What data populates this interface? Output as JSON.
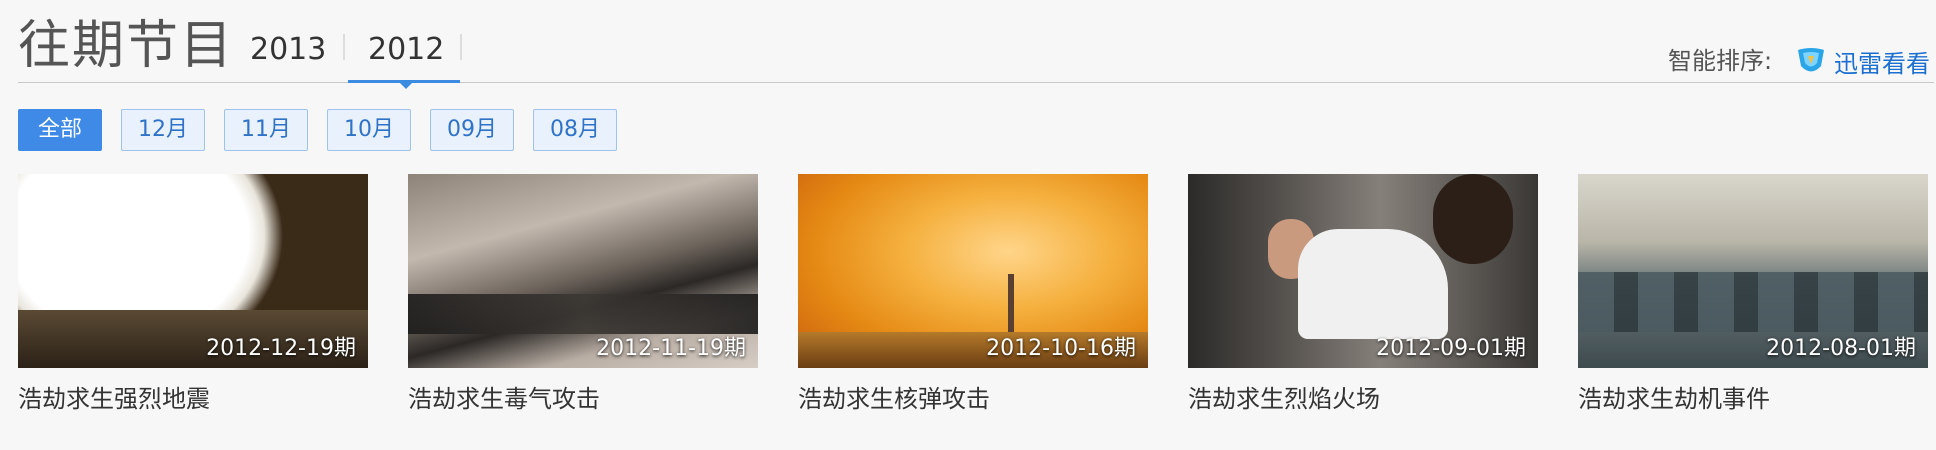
{
  "header": {
    "title": "往期节目",
    "year_tabs": [
      {
        "label": "2013",
        "active": false
      },
      {
        "label": "2012",
        "active": true
      }
    ],
    "sort_label": "智能排序:",
    "sort_link": {
      "label": "迅雷看看",
      "icon": "xunlei-logo-icon"
    }
  },
  "filters": [
    {
      "label": "全部",
      "active": true
    },
    {
      "label": "12月",
      "active": false
    },
    {
      "label": "11月",
      "active": false
    },
    {
      "label": "10月",
      "active": false
    },
    {
      "label": "09月",
      "active": false
    },
    {
      "label": "08月",
      "active": false
    }
  ],
  "episodes": [
    {
      "date": "2012-12-19期",
      "title": "浩劫求生强烈地震"
    },
    {
      "date": "2012-11-19期",
      "title": "浩劫求生毒气攻击"
    },
    {
      "date": "2012-10-16期",
      "title": "浩劫求生核弹攻击"
    },
    {
      "date": "2012-09-01期",
      "title": "浩劫求生烈焰火场"
    },
    {
      "date": "2012-08-01期",
      "title": "浩劫求生劫机事件"
    }
  ],
  "colors": {
    "accent": "#3e8ae6",
    "link": "#1a6fd0",
    "filter_bg": "#e8f1fc"
  }
}
